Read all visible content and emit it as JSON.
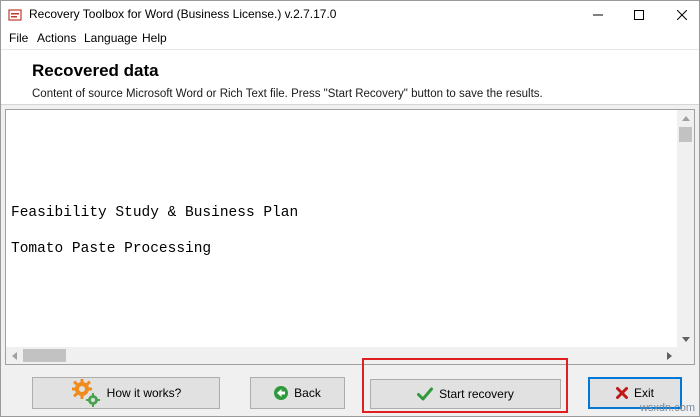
{
  "window": {
    "title": "Recovery Toolbox for Word (Business License.) v.2.7.17.0"
  },
  "menu": {
    "items": [
      "File",
      "Actions",
      "Language",
      "Help"
    ]
  },
  "header": {
    "title": "Recovered data",
    "subtitle": "Content of source Microsoft Word or Rich Text file. Press \"Start Recovery\" button to save the results."
  },
  "document": {
    "lines": [
      "Feasibility Study & Business Plan",
      "Tomato Paste Processing"
    ]
  },
  "buttons": {
    "how_it_works": "How it works?",
    "back": "Back",
    "start_recovery": "Start recovery",
    "exit": "Exit"
  },
  "watermark": "wsxdn.com",
  "colors": {
    "highlight": "#e02020",
    "default_button_border": "#0078d7",
    "back_icon": "#2e9a3c",
    "check_icon": "#2e9a3c",
    "exit_icon": "#c01818",
    "gear_icon": "#f08c1e"
  },
  "icons": {
    "app": "app-icon",
    "minimize": "minimize-icon",
    "maximize": "maximize-icon",
    "close": "close-icon",
    "how_it_works": "gears-icon",
    "back": "back-arrow-icon",
    "start_recovery": "checkmark-icon",
    "exit": "x-icon"
  }
}
